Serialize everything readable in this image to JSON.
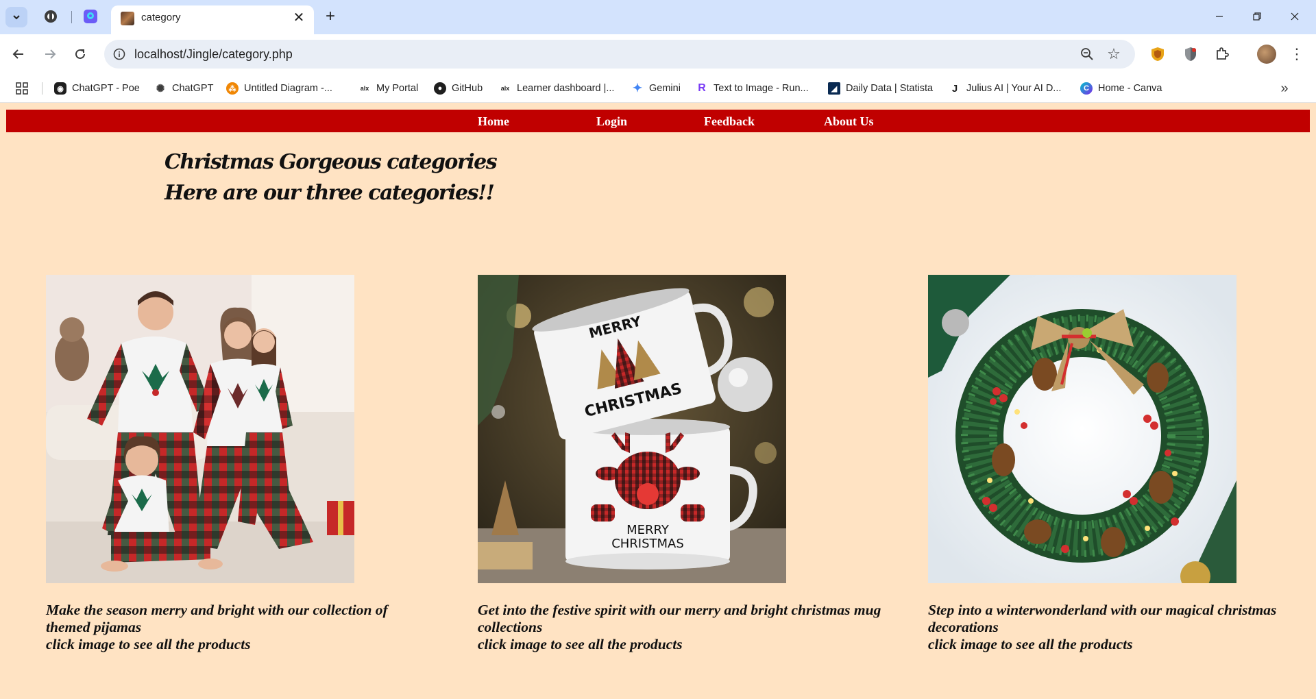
{
  "browser": {
    "tab_title": "category",
    "url": "localhost/Jingle/category.php",
    "bookmarks": [
      "ChatGPT - Poe",
      "ChatGPT",
      "Untitled Diagram -...",
      "My Portal",
      "GitHub",
      "Learner dashboard |...",
      "Gemini",
      "Text to Image - Run...",
      "Daily Data | Statista",
      "Julius AI | Your AI D...",
      "Home - Canva"
    ]
  },
  "nav": {
    "links": [
      "Home",
      "Login",
      "Feedback",
      "About Us"
    ]
  },
  "heading": {
    "line1": "Christmas Gorgeous categories",
    "line2": "Here are our three categories!!"
  },
  "categories": [
    {
      "description": "Make the season merry and bright with our collection of themed pijamas",
      "cta": "click image to see all the products"
    },
    {
      "description": "Get into the festive spirit with our merry and bright christmas mug collections",
      "cta": "click image to see all the products"
    },
    {
      "description": "Step into a winterwonderland with our magical christmas decorations",
      "cta": "click image to see all the products"
    }
  ],
  "image_text": {
    "mug_top_1": "MERRY",
    "mug_top_2": "CHRISTMAS",
    "mug_bottom_1": "MERRY",
    "mug_bottom_2": "CHRISTMAS"
  },
  "colors": {
    "page_bg": "#ffe3c3",
    "nav_bg": "#c00000",
    "tabbar_bg": "#d3e3fd"
  }
}
